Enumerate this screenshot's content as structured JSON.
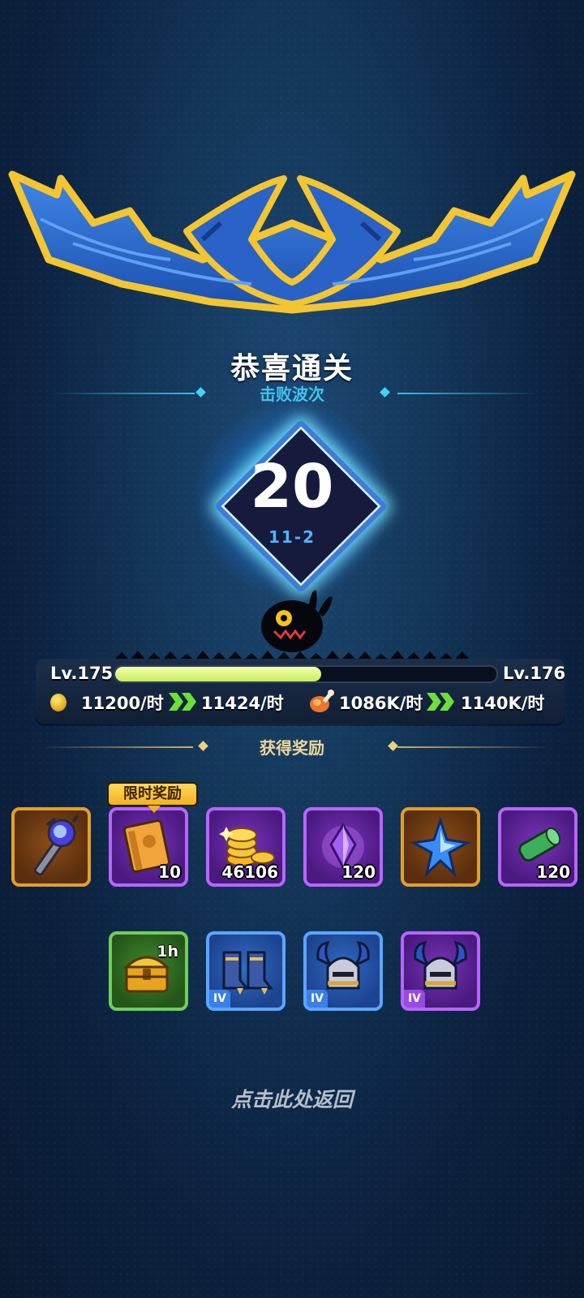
{
  "result": {
    "title": "恭喜通关",
    "wave_label": "击败波次",
    "wave_count": "20",
    "stage": "11-2"
  },
  "level": {
    "current": "Lv.175",
    "next": "Lv.176",
    "progress": 0.54
  },
  "rates": {
    "gold_current": "11200/时",
    "gold_next": "11424/时",
    "food_current": "1086K/时",
    "food_next": "1140K/时"
  },
  "rewards": {
    "section_label": "获得奖励",
    "limited_badge": "限时奖励",
    "row1": [
      {
        "icon": "staff-icon",
        "rarity": "orange",
        "qty": ""
      },
      {
        "icon": "book-icon",
        "rarity": "purple",
        "qty": "10"
      },
      {
        "icon": "gold-coins-icon",
        "rarity": "purple",
        "qty": "46106"
      },
      {
        "icon": "purple-crystal-icon",
        "rarity": "purple",
        "qty": "120"
      },
      {
        "icon": "blue-star-shard-icon",
        "rarity": "orange",
        "qty": ""
      },
      {
        "icon": "green-scroll-icon",
        "rarity": "purple",
        "qty": "120"
      }
    ],
    "row2": [
      {
        "icon": "treasure-chest-icon",
        "rarity": "green",
        "time": "1h"
      },
      {
        "icon": "armored-boots-icon",
        "rarity": "blue",
        "tier": "IV"
      },
      {
        "icon": "horned-helmet-icon",
        "rarity": "blue",
        "tier": "IV"
      },
      {
        "icon": "horned-helmet-icon",
        "rarity": "purple",
        "tier": "IV"
      }
    ]
  },
  "footer": {
    "return_label": "点击此处返回"
  },
  "colors": {
    "background": "#133456",
    "wave_accent": "#3fc3ee",
    "reward_accent": "#f2d79a",
    "xp_fill": "#d4f06a"
  }
}
